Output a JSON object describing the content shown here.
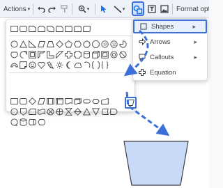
{
  "toolbar": {
    "actions_label": "Actions",
    "format_label": "Format optio"
  },
  "shapes_menu": {
    "items": [
      {
        "label": "Shapes",
        "chevron": "▸"
      },
      {
        "label": "Arrows",
        "chevron": "▸"
      },
      {
        "label": "Callouts",
        "chevron": "▸"
      },
      {
        "label": "Equation",
        "chevron": ""
      }
    ]
  },
  "annotation": {
    "arrow_color": "#3c6fd8",
    "shape_fill": "#c9daf8",
    "shape_stroke": "#3c4043"
  }
}
